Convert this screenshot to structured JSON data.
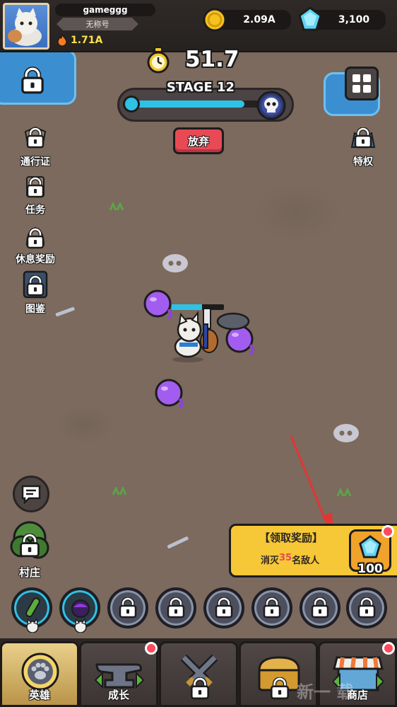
{
  "player": {
    "name": "gameggg",
    "title": "无称号",
    "power": "1.71A"
  },
  "currency": {
    "gold": "2.09A",
    "gems": "3,100"
  },
  "timer": "51.7",
  "stage": {
    "label": "STAGE 12",
    "progress": 0.83
  },
  "abandon_label": "放弃",
  "left_menu": [
    {
      "label": "通行证",
      "icon": "pass-icon"
    },
    {
      "label": "任务",
      "icon": "task-icon"
    },
    {
      "label": "休息奖励",
      "icon": "rest-reward-icon"
    },
    {
      "label": "图鉴",
      "icon": "codex-icon"
    }
  ],
  "right_menu": {
    "label": "特权",
    "icon": "privilege-icon"
  },
  "village_label": "村庄",
  "reward_banner": {
    "title": "【领取奖励】",
    "desc_prefix": "消灭",
    "desc_number": "35",
    "desc_suffix": "名敌人",
    "amount": "100"
  },
  "bottom_nav": [
    {
      "label": "英雄",
      "icon": "paw-icon",
      "locked": false
    },
    {
      "label": "成长",
      "icon": "anvil-icon",
      "locked": false
    },
    {
      "label": "",
      "icon": "crossed-swords-icon",
      "locked": true
    },
    {
      "label": "",
      "icon": "treasure-chest-icon",
      "locked": true
    },
    {
      "label": "商店",
      "icon": "shop-icon",
      "locked": false
    }
  ],
  "watermark": "新一   载",
  "colors": {
    "accent_blue": "#2fc2e6",
    "abandon_red": "#e84a55",
    "reward_yellow": "#f6c737",
    "enemy_purple": "#a35cf0"
  }
}
